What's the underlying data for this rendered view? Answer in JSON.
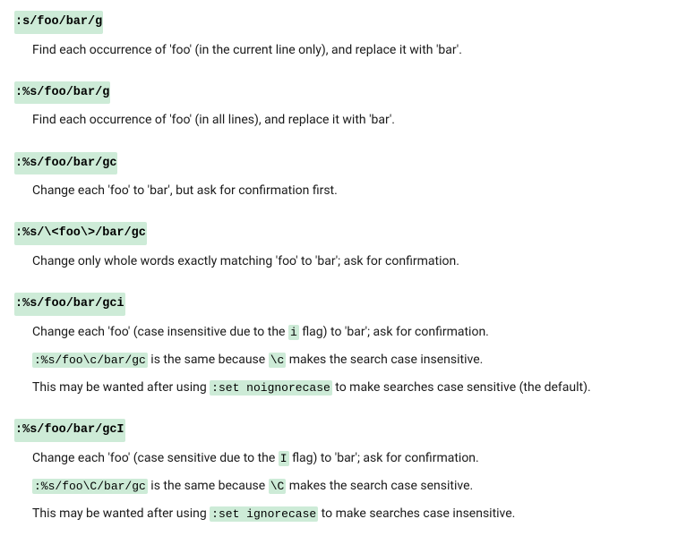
{
  "e0": {
    "cmd": ":s/foo/bar/g",
    "l0": "Find each occurrence of 'foo' (in the current line only), and replace it with 'bar'."
  },
  "e1": {
    "cmd": ":%s/foo/bar/g",
    "l0": "Find each occurrence of 'foo' (in all lines), and replace it with 'bar'."
  },
  "e2": {
    "cmd": ":%s/foo/bar/gc",
    "l0": "Change each 'foo' to 'bar', but ask for confirmation first."
  },
  "e3": {
    "cmd": ":%s/\\<foo\\>/bar/gc",
    "l0": "Change only whole words exactly matching 'foo' to 'bar'; ask for confirmation."
  },
  "e4": {
    "cmd": ":%s/foo/bar/gci",
    "l0a": "Change each 'foo' (case insensitive due to the ",
    "l0b": "i",
    "l0c": " flag) to 'bar'; ask for confirmation.",
    "l1a": ":%s/foo\\c/bar/gc",
    "l1b": " is the same because ",
    "l1c": "\\c",
    "l1d": " makes the search case insensitive.",
    "l2a": "This may be wanted after using ",
    "l2b": ":set noignorecase",
    "l2c": " to make searches case sensitive (the default)."
  },
  "e5": {
    "cmd": ":%s/foo/bar/gcI",
    "l0a": "Change each 'foo' (case sensitive due to the ",
    "l0b": "I",
    "l0c": " flag) to 'bar'; ask for confirmation.",
    "l1a": ":%s/foo\\C/bar/gc",
    "l1b": " is the same because ",
    "l1c": "\\C",
    "l1d": " makes the search case sensitive.",
    "l2a": "This may be wanted after using ",
    "l2b": ":set ignorecase",
    "l2c": " to make searches case insensitive."
  }
}
